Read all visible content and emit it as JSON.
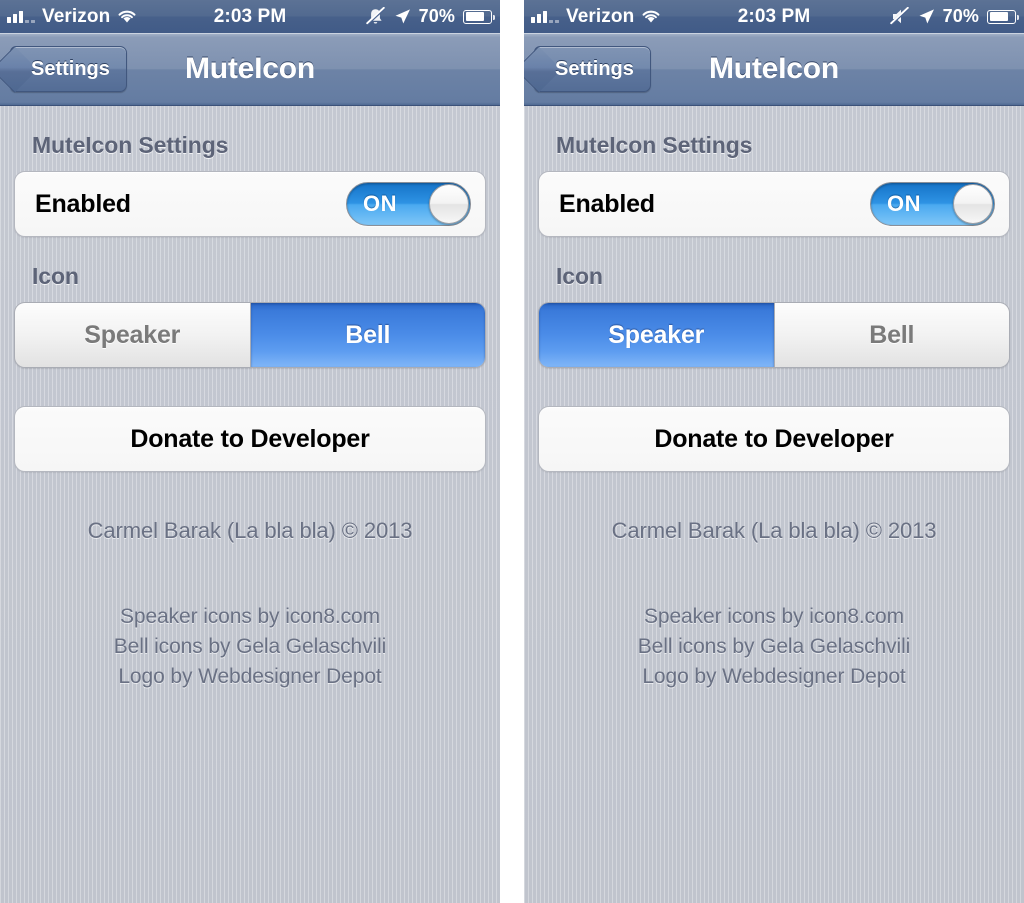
{
  "panels": [
    {
      "status_bar": {
        "carrier": "Verizon",
        "time": "2:03 PM",
        "battery_percent": "70%",
        "signal_icon": "signal-bars-icon",
        "wifi_icon": "wifi-icon",
        "mute_icon": "bell-muted-icon",
        "location_icon": "location-arrow-icon",
        "battery_icon": "battery-icon"
      },
      "nav": {
        "back_label": "Settings",
        "title": "MuteIcon",
        "back_icon": "chevron-left-icon"
      },
      "sections": {
        "settings_header": "MuteIcon Settings",
        "enabled_label": "Enabled",
        "enabled_state": "ON",
        "icon_header": "Icon",
        "segments": [
          "Speaker",
          "Bell"
        ],
        "selected_segment": "Bell",
        "donate_label": "Donate to Developer"
      },
      "footer": {
        "copyright": "Carmel Barak (La bla bla) © 2013",
        "credits": [
          "Speaker icons by icon8.com",
          "Bell icons by Gela Gelaschvili",
          "Logo by Webdesigner Depot"
        ]
      }
    },
    {
      "status_bar": {
        "carrier": "Verizon",
        "time": "2:03 PM",
        "battery_percent": "70%",
        "signal_icon": "signal-bars-icon",
        "wifi_icon": "wifi-icon",
        "mute_icon": "speaker-muted-icon",
        "location_icon": "location-arrow-icon",
        "battery_icon": "battery-icon"
      },
      "nav": {
        "back_label": "Settings",
        "title": "MuteIcon",
        "back_icon": "chevron-left-icon"
      },
      "sections": {
        "settings_header": "MuteIcon Settings",
        "enabled_label": "Enabled",
        "enabled_state": "ON",
        "icon_header": "Icon",
        "segments": [
          "Speaker",
          "Bell"
        ],
        "selected_segment": "Speaker",
        "donate_label": "Donate to Developer"
      },
      "footer": {
        "copyright": "Carmel Barak (La bla bla) © 2013",
        "credits": [
          "Speaker icons by icon8.com",
          "Bell icons by Gela Gelaschvili",
          "Logo by Webdesigner Depot"
        ]
      }
    }
  ],
  "colors": {
    "accent_blue": "#3a7ada",
    "toggle_blue": "#2e93e4",
    "navbar_blue": "#6d83a6",
    "statusbar_blue": "#4b6490",
    "background_gray": "#c4c8d1",
    "header_text": "#5d6478",
    "footer_text": "#6a7184"
  }
}
